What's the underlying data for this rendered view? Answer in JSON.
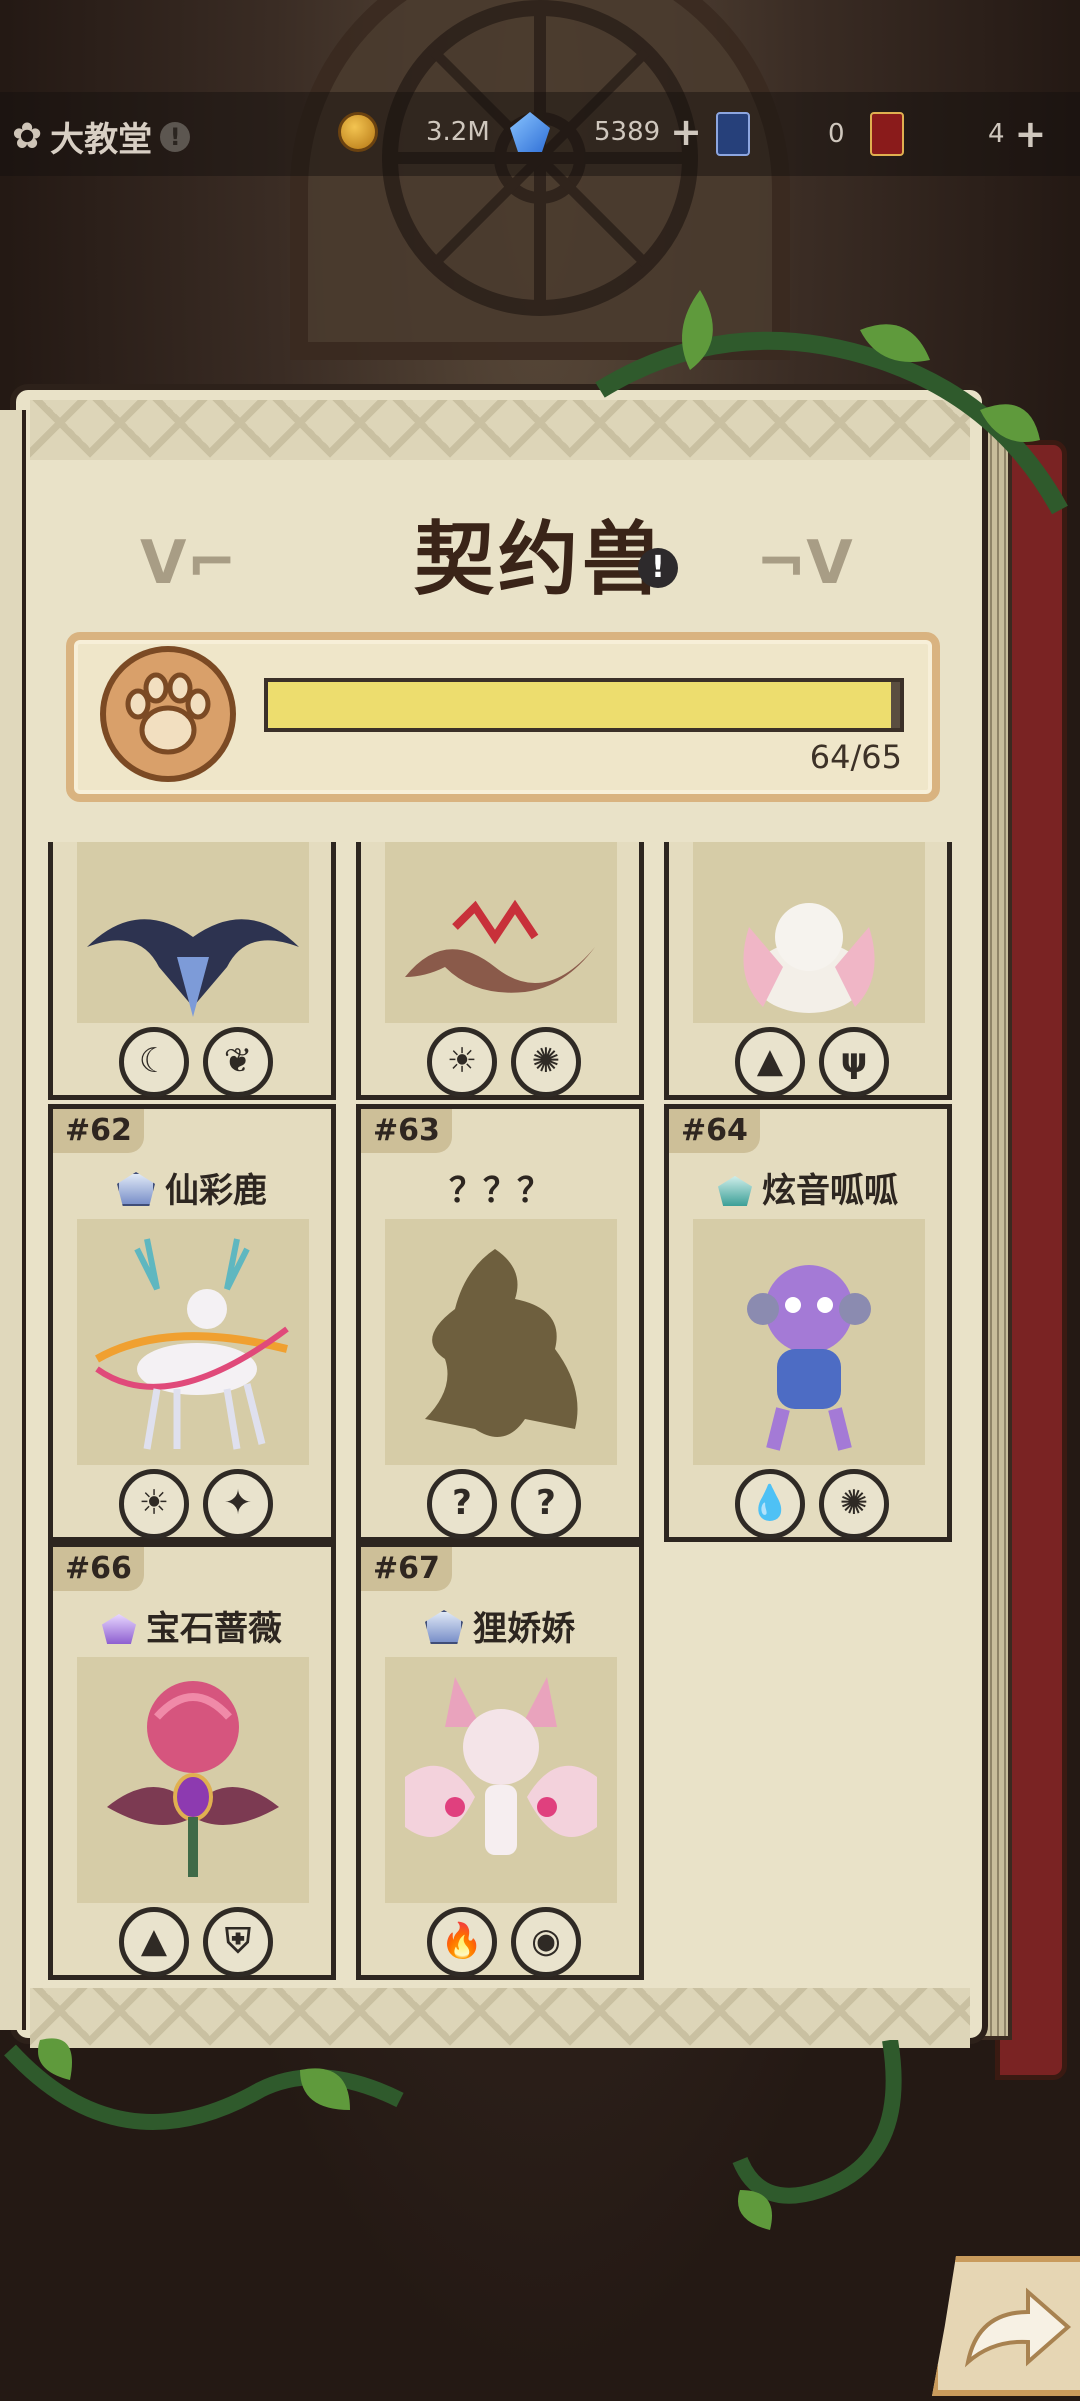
{
  "location": {
    "name": "大教堂",
    "info": "!"
  },
  "resources": [
    {
      "icon": "gold-coin-icon",
      "value": "3.2M",
      "plus": false
    },
    {
      "icon": "blue-gem-icon",
      "value": "5389",
      "plus": true
    },
    {
      "icon": "blue-card-ticket-icon",
      "value": "0",
      "plus": false
    },
    {
      "icon": "red-card-ticket-icon",
      "value": "4",
      "plus": true
    }
  ],
  "book": {
    "title": "契约兽",
    "title_info": "!",
    "progress": {
      "text": "64/65",
      "fraction": 0.985
    }
  },
  "cards": [
    {
      "num": "",
      "name": "",
      "elements": [
        "moon-icon",
        "leaf-icon"
      ]
    },
    {
      "num": "",
      "name": "",
      "elements": [
        "sun-icon",
        "wind-swirl-icon"
      ]
    },
    {
      "num": "",
      "name": "",
      "elements": [
        "earth-rock-icon",
        "sprout-icon"
      ]
    },
    {
      "num": "#62",
      "name": "仙彩鹿",
      "crest": "blue",
      "elements": [
        "sun-icon",
        "star-compass-icon"
      ]
    },
    {
      "num": "#63",
      "name": "？？？",
      "crest": "",
      "elements": [
        "question-icon",
        "question-icon"
      ]
    },
    {
      "num": "#64",
      "name": "炫音呱呱",
      "crest": "teal",
      "elements": [
        "water-drop-icon",
        "wind-swirl-icon"
      ]
    },
    {
      "num": "#66",
      "name": "宝石蔷薇",
      "crest": "purple",
      "elements": [
        "earth-rock-icon",
        "shield-icon"
      ]
    },
    {
      "num": "#67",
      "name": "狸娇娇",
      "crest": "blue",
      "elements": [
        "fire-icon",
        "spirit-icon"
      ]
    }
  ],
  "question_mark": "?",
  "colors": {
    "progress_fill": "#eddd6e",
    "card_bg": "#e4dcbf",
    "book_cover": "#7a2323"
  }
}
